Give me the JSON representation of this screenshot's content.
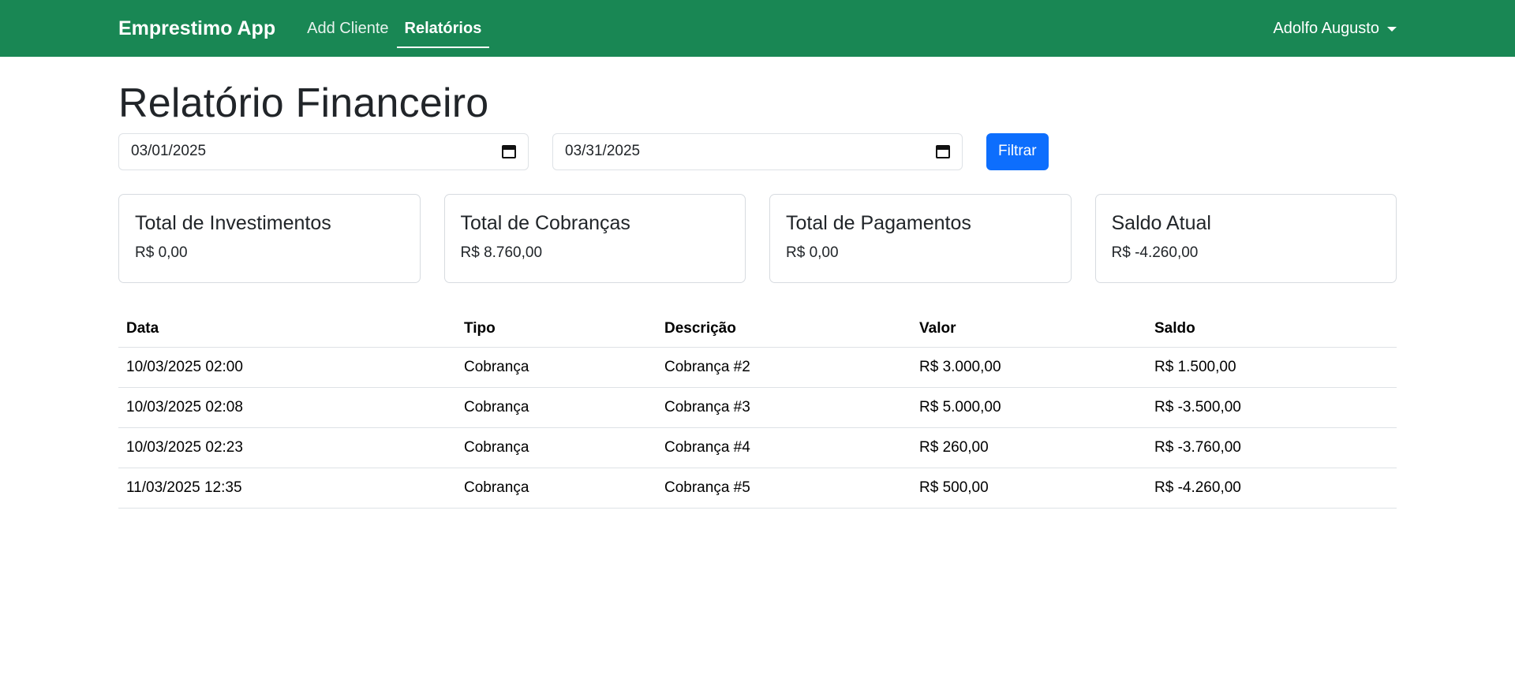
{
  "navbar": {
    "brand": "Emprestimo App",
    "links": [
      {
        "label": "Add Cliente",
        "active": false
      },
      {
        "label": "Relatórios",
        "active": true
      }
    ],
    "user": "Adolfo Augusto"
  },
  "page": {
    "title": "Relatório Financeiro"
  },
  "filters": {
    "start_date": "03/01/2025",
    "end_date": "03/31/2025",
    "button_label": "Filtrar"
  },
  "cards": [
    {
      "title": "Total de Investimentos",
      "value": "R$ 0,00"
    },
    {
      "title": "Total de Cobranças",
      "value": "R$ 8.760,00"
    },
    {
      "title": "Total de Pagamentos",
      "value": "R$ 0,00"
    },
    {
      "title": "Saldo Atual",
      "value": "R$ -4.260,00"
    }
  ],
  "table": {
    "headers": [
      "Data",
      "Tipo",
      "Descrição",
      "Valor",
      "Saldo"
    ],
    "rows": [
      [
        "10/03/2025 02:00",
        "Cobrança",
        "Cobrança #2",
        "R$ 3.000,00",
        "R$ 1.500,00"
      ],
      [
        "10/03/2025 02:08",
        "Cobrança",
        "Cobrança #3",
        "R$ 5.000,00",
        "R$ -3.500,00"
      ],
      [
        "10/03/2025 02:23",
        "Cobrança",
        "Cobrança #4",
        "R$ 260,00",
        "R$ -3.760,00"
      ],
      [
        "11/03/2025 12:35",
        "Cobrança",
        "Cobrança #5",
        "R$ 500,00",
        "R$ -4.260,00"
      ]
    ]
  },
  "colors": {
    "navbar": "#198754",
    "primary_button": "#0d6efd"
  }
}
